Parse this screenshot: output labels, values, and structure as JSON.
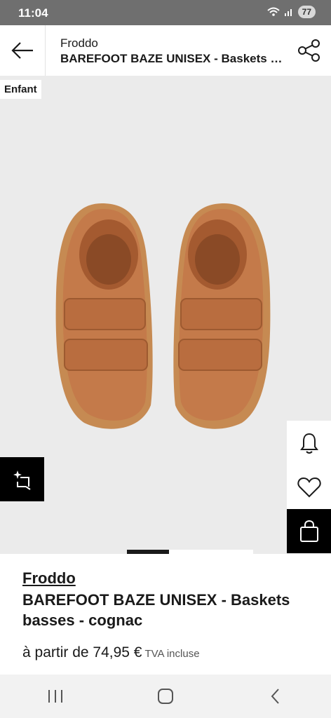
{
  "status": {
    "time": "11:04",
    "battery": "77"
  },
  "header": {
    "brand": "Froddo",
    "title": "BAREFOOT BAZE UNISEX - Baskets basses - cognac"
  },
  "gallery": {
    "tag": "Enfant",
    "active_index": 1,
    "image_count": 2
  },
  "product": {
    "brand": "Froddo",
    "name": "BAREFOOT BAZE UNISEX - Baskets basses - cognac",
    "price_label": "à partir de 74,95 €",
    "tax_note": "TVA incluse"
  },
  "icons": {
    "back": "arrow-left-icon",
    "share": "share-icon",
    "try_on": "sparkle-crop-icon",
    "alert": "bell-icon",
    "wishlist": "heart-icon",
    "bag": "shopping-bag-icon",
    "recents": "recents-icon",
    "home": "home-icon",
    "nav_back": "chevron-left-icon"
  },
  "colors": {
    "shoe": "#c47a4a",
    "sole": "#c68a52",
    "status_bar": "#6f6f6f",
    "gallery_bg": "#ebebeb",
    "accent": "#000000"
  }
}
